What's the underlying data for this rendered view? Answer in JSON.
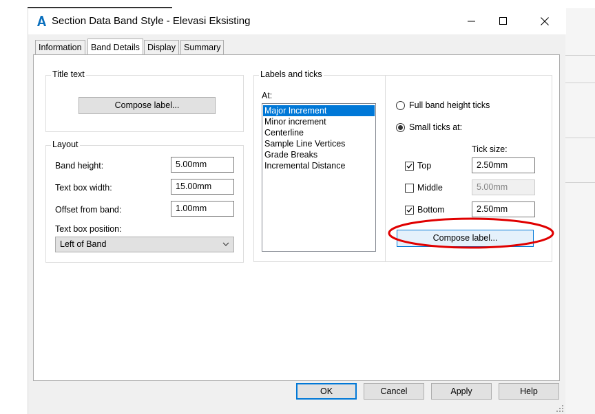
{
  "window": {
    "title": "Section Data Band Style - Elevasi Eksisting"
  },
  "tabs": [
    {
      "label": "Information"
    },
    {
      "label": "Band Details"
    },
    {
      "label": "Display"
    },
    {
      "label": "Summary"
    }
  ],
  "title_text": {
    "group_title": "Title text",
    "compose_label": "Compose label..."
  },
  "layout": {
    "group_title": "Layout",
    "band_height_label": "Band height:",
    "band_height_value": "5.00mm",
    "text_box_width_label": "Text box width:",
    "text_box_width_value": "15.00mm",
    "offset_label": "Offset from band:",
    "offset_value": "1.00mm",
    "position_label": "Text box position:",
    "position_value": "Left of Band"
  },
  "labels_ticks": {
    "group_title": "Labels and ticks",
    "at_label": "At:",
    "at_items": [
      "Major Increment",
      "Minor increment",
      "Centerline",
      "Sample Line Vertices",
      "Grade Breaks",
      "Incremental Distance"
    ],
    "full_band_label": "Full band height ticks",
    "small_ticks_label": "Small ticks at:",
    "tick_size_label": "Tick size:",
    "top_label": "Top",
    "top_value": "2.50mm",
    "middle_label": "Middle",
    "middle_value": "5.00mm",
    "bottom_label": "Bottom",
    "bottom_value": "2.50mm",
    "compose_label": "Compose label..."
  },
  "footer": {
    "ok": "OK",
    "cancel": "Cancel",
    "apply": "Apply",
    "help": "Help"
  },
  "colors": {
    "accent": "#0078d7",
    "annotation": "#e00000"
  }
}
